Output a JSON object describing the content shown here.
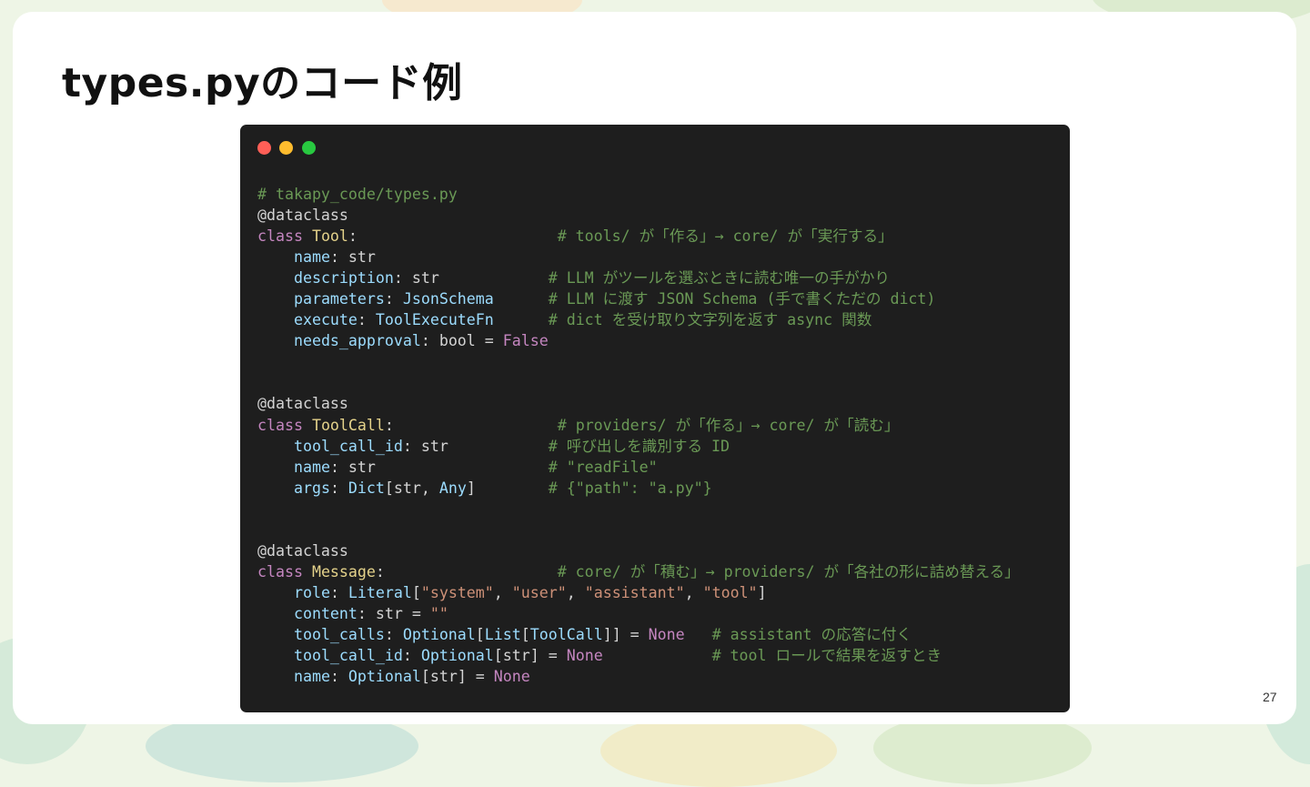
{
  "slide": {
    "title": "types.pyのコード例",
    "page_number": "27"
  },
  "window_controls": {
    "colors": {
      "close": "#ff5f57",
      "minimize": "#febc2e",
      "zoom": "#28c840"
    }
  },
  "code_lines": [
    [
      [
        "c",
        "# takapy_code/types.py"
      ]
    ],
    [
      [
        "pl",
        "@dataclass"
      ]
    ],
    [
      [
        "k",
        "class"
      ],
      [
        "pl",
        " "
      ],
      [
        "cl",
        "Tool"
      ],
      [
        "pl",
        ":                      "
      ],
      [
        "c",
        "# tools/ が「作る」→ core/ が「実行する」"
      ]
    ],
    [
      [
        "pl",
        "    "
      ],
      [
        "at",
        "name"
      ],
      [
        "pl",
        ": str"
      ]
    ],
    [
      [
        "pl",
        "    "
      ],
      [
        "at",
        "description"
      ],
      [
        "pl",
        ": str            "
      ],
      [
        "c",
        "# LLM がツールを選ぶときに読む唯一の手がかり"
      ]
    ],
    [
      [
        "pl",
        "    "
      ],
      [
        "at",
        "parameters"
      ],
      [
        "pl",
        ": "
      ],
      [
        "ty",
        "JsonSchema"
      ],
      [
        "pl",
        "      "
      ],
      [
        "c",
        "# LLM に渡す JSON Schema (手で書くただの dict)"
      ]
    ],
    [
      [
        "pl",
        "    "
      ],
      [
        "at",
        "execute"
      ],
      [
        "pl",
        ": "
      ],
      [
        "ty",
        "ToolExecuteFn"
      ],
      [
        "pl",
        "      "
      ],
      [
        "c",
        "# dict を受け取り文字列を返す async 関数"
      ]
    ],
    [
      [
        "pl",
        "    "
      ],
      [
        "at",
        "needs_approval"
      ],
      [
        "pl",
        ": bool = "
      ],
      [
        "k",
        "False"
      ]
    ],
    [],
    [],
    [
      [
        "pl",
        "@dataclass"
      ]
    ],
    [
      [
        "k",
        "class"
      ],
      [
        "pl",
        " "
      ],
      [
        "cl",
        "ToolCall"
      ],
      [
        "pl",
        ":                  "
      ],
      [
        "c",
        "# providers/ が「作る」→ core/ が「読む」"
      ]
    ],
    [
      [
        "pl",
        "    "
      ],
      [
        "at",
        "tool_call_id"
      ],
      [
        "pl",
        ": str           "
      ],
      [
        "c",
        "# 呼び出しを識別する ID"
      ]
    ],
    [
      [
        "pl",
        "    "
      ],
      [
        "at",
        "name"
      ],
      [
        "pl",
        ": str                   "
      ],
      [
        "c",
        "# \"readFile\""
      ]
    ],
    [
      [
        "pl",
        "    "
      ],
      [
        "at",
        "args"
      ],
      [
        "pl",
        ": "
      ],
      [
        "ty",
        "Dict"
      ],
      [
        "pl",
        "[str, "
      ],
      [
        "ty",
        "Any"
      ],
      [
        "pl",
        "]        "
      ],
      [
        "c",
        "# {\"path\": \"a.py\"}"
      ]
    ],
    [],
    [],
    [
      [
        "pl",
        "@dataclass"
      ]
    ],
    [
      [
        "k",
        "class"
      ],
      [
        "pl",
        " "
      ],
      [
        "cl",
        "Message"
      ],
      [
        "pl",
        ":                   "
      ],
      [
        "c",
        "# core/ が「積む」→ providers/ が「各社の形に詰め替える」"
      ]
    ],
    [
      [
        "pl",
        "    "
      ],
      [
        "at",
        "role"
      ],
      [
        "pl",
        ": "
      ],
      [
        "ty",
        "Literal"
      ],
      [
        "pl",
        "["
      ],
      [
        "s",
        "\"system\""
      ],
      [
        "pl",
        ", "
      ],
      [
        "s",
        "\"user\""
      ],
      [
        "pl",
        ", "
      ],
      [
        "s",
        "\"assistant\""
      ],
      [
        "pl",
        ", "
      ],
      [
        "s",
        "\"tool\""
      ],
      [
        "pl",
        "]"
      ]
    ],
    [
      [
        "pl",
        "    "
      ],
      [
        "at",
        "content"
      ],
      [
        "pl",
        ": str = "
      ],
      [
        "s",
        "\"\""
      ]
    ],
    [
      [
        "pl",
        "    "
      ],
      [
        "at",
        "tool_calls"
      ],
      [
        "pl",
        ": "
      ],
      [
        "ty",
        "Optional"
      ],
      [
        "pl",
        "["
      ],
      [
        "ty",
        "List"
      ],
      [
        "pl",
        "["
      ],
      [
        "ty",
        "ToolCall"
      ],
      [
        "pl",
        "]] = "
      ],
      [
        "k",
        "None"
      ],
      [
        "pl",
        "   "
      ],
      [
        "c",
        "# assistant の応答に付く"
      ]
    ],
    [
      [
        "pl",
        "    "
      ],
      [
        "at",
        "tool_call_id"
      ],
      [
        "pl",
        ": "
      ],
      [
        "ty",
        "Optional"
      ],
      [
        "pl",
        "[str] = "
      ],
      [
        "k",
        "None"
      ],
      [
        "pl",
        "            "
      ],
      [
        "c",
        "# tool ロールで結果を返すとき"
      ]
    ],
    [
      [
        "pl",
        "    "
      ],
      [
        "at",
        "name"
      ],
      [
        "pl",
        ": "
      ],
      [
        "ty",
        "Optional"
      ],
      [
        "pl",
        "[str] = "
      ],
      [
        "k",
        "None"
      ]
    ]
  ]
}
